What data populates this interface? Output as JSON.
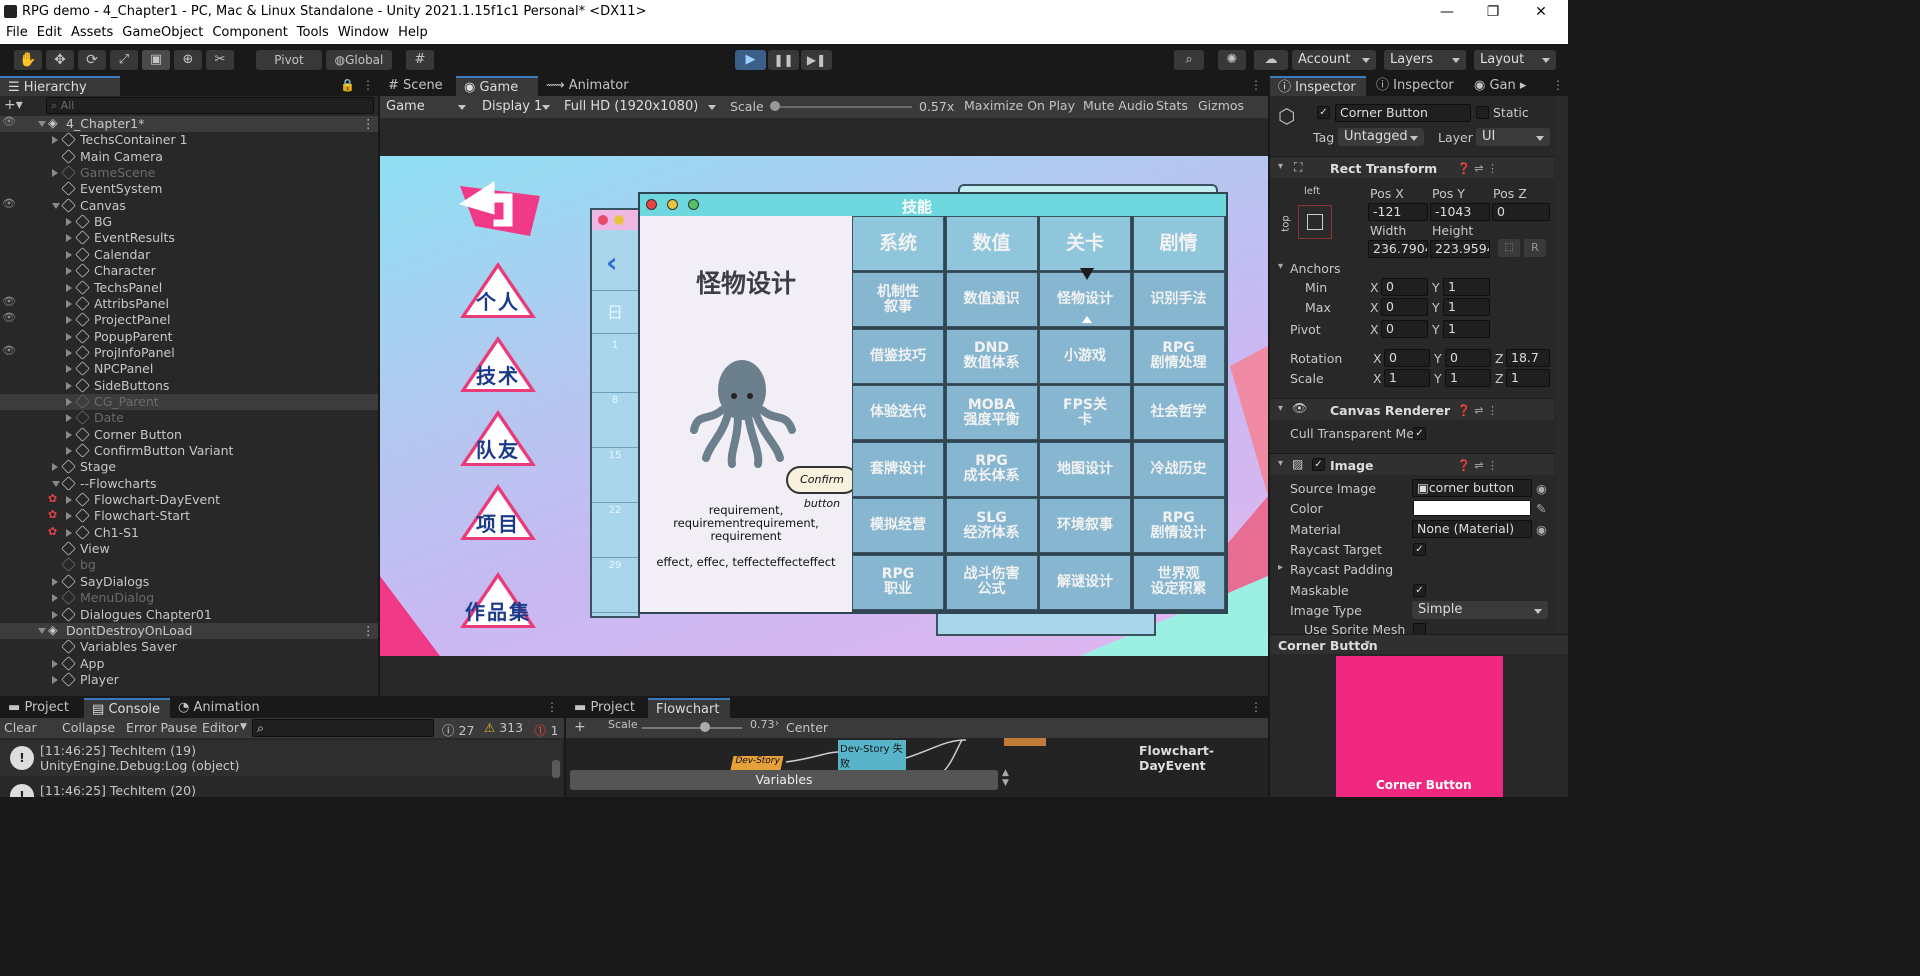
{
  "window": {
    "title": "RPG demo - 4_Chapter1 - PC, Mac & Linux Standalone - Unity 2021.1.15f1c1 Personal* <DX11>",
    "controls": [
      "—",
      "❐",
      "✕"
    ]
  },
  "menu": [
    "File",
    "Edit",
    "Assets",
    "GameObject",
    "Component",
    "Tools",
    "Window",
    "Help"
  ],
  "toolbar": {
    "pivot": "Pivot",
    "global": "Global",
    "account": "Account",
    "layers": "Layers",
    "layout": "Layout"
  },
  "hierarchy": {
    "tab": "Hierarchy",
    "search_placeholder": "All",
    "scene": "4_Chapter1*",
    "items": [
      "TechsContainer 1",
      "Main Camera",
      "GameScene",
      "EventSystem",
      "Canvas",
      "BG",
      "EventResults",
      "Calendar",
      "Character",
      "TechsPanel",
      "AttribsPanel",
      "ProjectPanel",
      "PopupParent",
      "ProjInfoPanel",
      "NPCPanel",
      "SideButtons",
      "CG_Parent",
      "Date",
      "Corner Button",
      "ConfirmButton Variant",
      "Stage",
      "--Flowcharts",
      "Flowchart-DayEvent",
      "Flowchart-Start",
      "Ch1-S1",
      "View",
      "bg",
      "SayDialogs",
      "MenuDialog",
      "Dialogues Chapter01"
    ],
    "dont_destroy": "DontDestroyOnLoad",
    "dd_items": [
      "Variables Saver",
      "App",
      "Player"
    ]
  },
  "center_tabs": [
    "Scene",
    "Game",
    "Animator"
  ],
  "game_bar": {
    "mode": "Game",
    "display": "Display 1",
    "resolution": "Full HD (1920x1080)",
    "scale_label": "Scale",
    "scale_value": "0.57x",
    "maximize": "Maximize On Play",
    "mute": "Mute Audio",
    "stats": "Stats",
    "gizmos": "Gizmos"
  },
  "game": {
    "window_title": "技能",
    "side_nav": [
      "个人",
      "技术",
      "队友",
      "项目",
      "作品集"
    ],
    "detail_title": "怪物设计",
    "requirement": "requirement, requirementrequirement, requirement",
    "effect": "effect, effec, teffecteffecteffect",
    "confirm": "Confirm button",
    "calendar_day": "日",
    "calendar_dates": [
      "1",
      "8",
      "15",
      "22",
      "29"
    ],
    "headers": [
      "系统",
      "数值",
      "关卡",
      "剧情"
    ],
    "grid": [
      [
        "机制性\n叙事",
        "数值通识",
        "怪物设计",
        "识别手法"
      ],
      [
        "借鉴技巧",
        "DND\n数值体系",
        "小游戏",
        "RPG\n剧情处理"
      ],
      [
        "体验迭代",
        "MOBA\n强度平衡",
        "FPS关\n卡",
        "社会哲学"
      ],
      [
        "套牌设计",
        "RPG\n成长体系",
        "地图设计",
        "冷战历史"
      ],
      [
        "模拟经营",
        "SLG\n经济体系",
        "环境叙事",
        "RPG\n剧情设计"
      ],
      [
        "RPG\n职业",
        "战斗伤害\n公式",
        "解谜设计",
        "世界观\n设定积累"
      ]
    ],
    "colors": {
      "pink": "#e93b7a",
      "cell": "#87b6d0",
      "header": "#8fc6db",
      "title_bar": "#6fd8df"
    }
  },
  "inspector": {
    "tabs": [
      "Inspector",
      "Inspector",
      "Gan"
    ],
    "object_name": "Corner Button",
    "static": "Static",
    "tag_label": "Tag",
    "tag": "Untagged",
    "layer_label": "Layer",
    "layer": "UI",
    "rect_transform": {
      "title": "Rect Transform",
      "anchor_h": "left",
      "anchor_v": "top",
      "pos_x_label": "Pos X",
      "pos_x": "-121",
      "pos_y_label": "Pos Y",
      "pos_y": "-1043",
      "pos_z_label": "Pos Z",
      "pos_z": "0",
      "width_label": "Width",
      "width": "236.7904",
      "height_label": "Height",
      "height": "223.9594",
      "anchors": "Anchors",
      "min": "Min",
      "min_x": "0",
      "min_y": "1",
      "max": "Max",
      "max_x": "0",
      "max_y": "1",
      "pivot": "Pivot",
      "pivot_x": "0",
      "pivot_y": "1",
      "rotation": "Rotation",
      "rot_x": "0",
      "rot_y": "0",
      "rot_z": "18.7",
      "scale": "Scale",
      "scale_x": "1",
      "scale_y": "1",
      "scale_z": "1",
      "r_btn": "R"
    },
    "canvas_renderer": {
      "title": "Canvas Renderer",
      "cull": "Cull Transparent Me"
    },
    "image": {
      "title": "Image",
      "source_label": "Source Image",
      "source": "corner button",
      "color_label": "Color",
      "material_label": "Material",
      "material": "None (Material)",
      "raycast_target": "Raycast Target",
      "raycast_padding": "Raycast Padding",
      "maskable": "Maskable",
      "image_type_label": "Image Type",
      "image_type": "Simple",
      "use_sprite_mesh": "Use Sprite Mesh"
    },
    "preview_title": "Corner Button",
    "preview_label": "Corner Button",
    "preview_color": "#f0287f"
  },
  "console": {
    "tabs": [
      "Project",
      "Console",
      "Animation"
    ],
    "clear": "Clear",
    "collapse": "Collapse",
    "error_pause": "Error Pause",
    "editor": "Editor",
    "count_info": "27",
    "count_warn": "313",
    "count_error": "1",
    "logs": [
      {
        "time": "[11:46:25] TechItem (19)",
        "detail": "UnityEngine.Debug:Log (object)"
      },
      {
        "time": "[11:46:25] TechItem (20)",
        "detail": ""
      }
    ]
  },
  "flowchart": {
    "tabs": [
      "Project",
      "Flowchart"
    ],
    "scale_label": "Scale",
    "scale_value": "0.73",
    "center": "Center",
    "name": "Flowchart-DayEvent",
    "variables": "Variables",
    "node1": "Dev-Story 失败",
    "node2": "Dev-Story"
  }
}
